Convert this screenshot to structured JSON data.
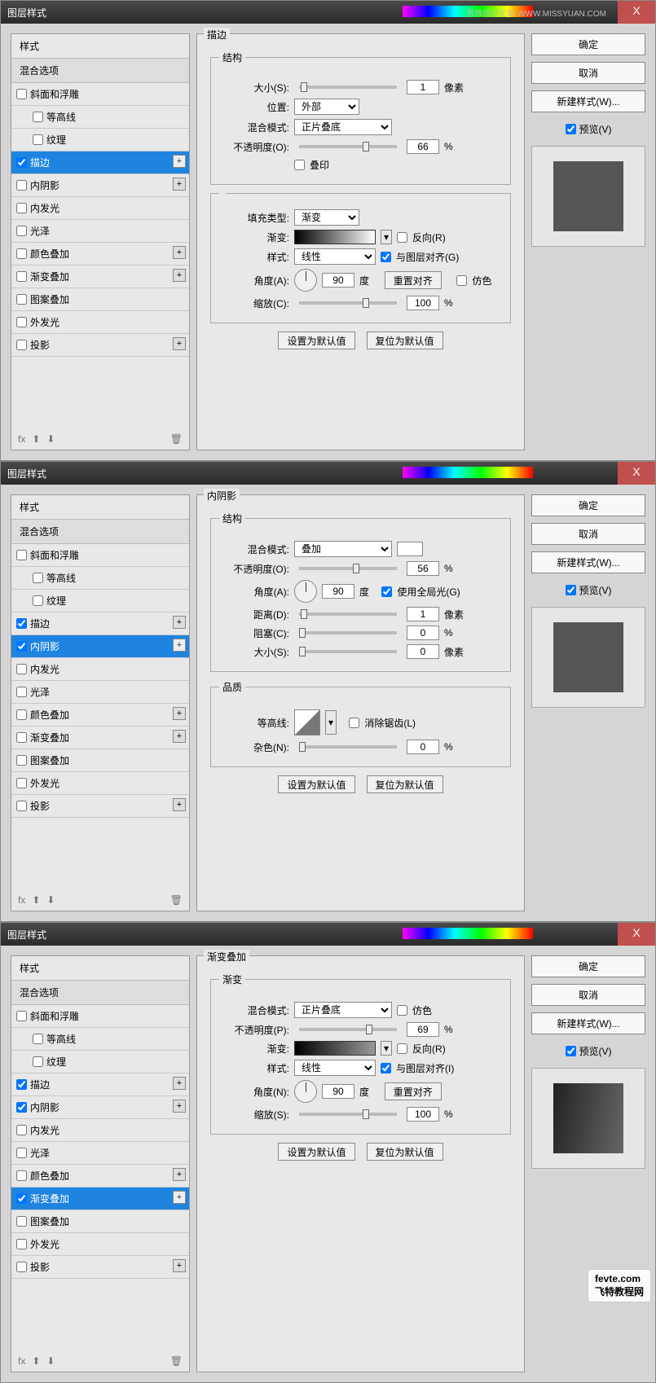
{
  "common": {
    "dialog_title": "图层样式",
    "watermark": "思缘设计论坛  WWW.MISSYUAN.COM",
    "close_x": "X",
    "styles_header": "样式",
    "blending_options": "混合选项",
    "btn_ok": "确定",
    "btn_cancel": "取消",
    "btn_new_style": "新建样式(W)...",
    "preview_label": "预览(V)",
    "make_default": "设置为默认值",
    "reset_default": "复位为默认值",
    "unit_px": "像素",
    "unit_pct": "%",
    "unit_deg": "度"
  },
  "style_items": [
    {
      "label": "斜面和浮雕",
      "hasPlus": false,
      "sub": false
    },
    {
      "label": "等高线",
      "hasPlus": false,
      "sub": true
    },
    {
      "label": "纹理",
      "hasPlus": false,
      "sub": true
    },
    {
      "label": "描边",
      "hasPlus": true,
      "sub": false
    },
    {
      "label": "内阴影",
      "hasPlus": true,
      "sub": false
    },
    {
      "label": "内发光",
      "hasPlus": false,
      "sub": false
    },
    {
      "label": "光泽",
      "hasPlus": false,
      "sub": false
    },
    {
      "label": "颜色叠加",
      "hasPlus": true,
      "sub": false
    },
    {
      "label": "渐变叠加",
      "hasPlus": true,
      "sub": false
    },
    {
      "label": "图案叠加",
      "hasPlus": false,
      "sub": false
    },
    {
      "label": "外发光",
      "hasPlus": false,
      "sub": false
    },
    {
      "label": "投影",
      "hasPlus": true,
      "sub": false
    }
  ],
  "footer": {
    "fx": "fx",
    "up": "⬆",
    "down": "⬇",
    "trash": "🗑"
  },
  "d1": {
    "checked": [
      "描边"
    ],
    "selected": "描边",
    "section": "描边",
    "group1": "结构",
    "size_lbl": "大小(S):",
    "size_val": "1",
    "position_lbl": "位置:",
    "position_val": "外部",
    "blend_lbl": "混合模式:",
    "blend_val": "正片叠底",
    "opacity_lbl": "不透明度(O):",
    "opacity_val": "66",
    "overprint": "叠印",
    "filltype_lbl": "填充类型:",
    "filltype_val": "渐变",
    "gradient_lbl": "渐变:",
    "reverse": "反向(R)",
    "style_lbl": "样式:",
    "style_val": "线性",
    "align": "与图层对齐(G)",
    "angle_lbl": "角度(A):",
    "angle_val": "90",
    "reset_align": "重置对齐",
    "dither": "仿色",
    "scale_lbl": "缩放(C):",
    "scale_val": "100"
  },
  "d2": {
    "checked": [
      "描边",
      "内阴影"
    ],
    "selected": "内阴影",
    "section": "内阴影",
    "group1": "结构",
    "group2": "品质",
    "blend_lbl": "混合模式:",
    "blend_val": "叠加",
    "opacity_lbl": "不透明度(O):",
    "opacity_val": "56",
    "angle_lbl": "角度(A):",
    "angle_val": "90",
    "global": "使用全局光(G)",
    "distance_lbl": "距离(D):",
    "distance_val": "1",
    "choke_lbl": "阻塞(C):",
    "choke_val": "0",
    "size_lbl": "大小(S):",
    "size_val": "0",
    "contour_lbl": "等高线:",
    "antialias": "消除锯齿(L)",
    "noise_lbl": "杂色(N):",
    "noise_val": "0"
  },
  "d3": {
    "checked": [
      "描边",
      "内阴影",
      "渐变叠加"
    ],
    "selected": "渐变叠加",
    "section": "渐变叠加",
    "group1": "渐变",
    "blend_lbl": "混合模式:",
    "blend_val": "正片叠底",
    "dither": "仿色",
    "opacity_lbl": "不透明度(P):",
    "opacity_val": "69",
    "gradient_lbl": "渐变:",
    "reverse": "反向(R)",
    "style_lbl": "样式:",
    "style_val": "线性",
    "align": "与图层对齐(I)",
    "angle_lbl": "角度(N):",
    "angle_val": "90",
    "reset_align": "重置对齐",
    "scale_lbl": "缩放(S):",
    "scale_val": "100"
  },
  "credit": {
    "top": "fevte.com",
    "bottom": "飞特教程网"
  }
}
